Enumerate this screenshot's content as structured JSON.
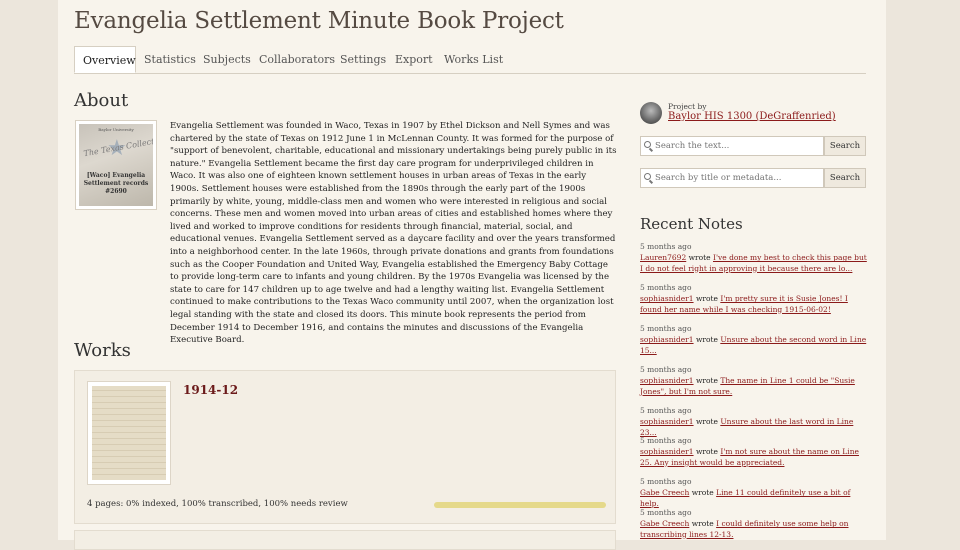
{
  "project_title": "Evangelia Settlement Minute Book Project",
  "tabs": [
    "Overview",
    "Statistics",
    "Subjects",
    "Collaborators",
    "Settings",
    "Export",
    "Works List"
  ],
  "about": {
    "heading": "About",
    "thumb": {
      "top": "Baylor University",
      "collection": "The Texas Collection",
      "label": "[Waco] Evangelia Settlement records #2690"
    },
    "text": "Evangelia Settlement was founded in Waco, Texas in 1907 by Ethel Dickson and Nell Symes and was chartered by the state of Texas on 1912 June 1 in McLennan County. It was formed for the purpose of \"support of benevolent, charitable, educational and missionary undertakings being purely public in its nature.\" Evangelia Settlement became the first day care program for underprivileged children in Waco. It was also one of eighteen known settlement houses in urban areas of Texas in the early 1900s. Settlement houses were established from the 1890s through the early part of the 1900s primarily by white, young, middle-class men and women who were interested in religious and social concerns. These men and women moved into urban areas of cities and established homes where they lived and worked to improve conditions for residents through financial, material, social, and educational venues. Evangelia Settlement served as a daycare facility and over the years transformed into a neighborhood center. In the late 1960s, through private donations and grants from foundations such as the Cooper Foundation and United Way, Evangelia established the Emergency Baby Cottage to provide long-term care to infants and young children. By the 1970s Evangelia was licensed by the state to care for 147 children up to age twelve and had a lengthy waiting list. Evangelia Settlement continued to make contributions to the Texas Waco community until 2007, when the organization lost legal standing with the state and closed its doors. This minute book represents the period from December 1914 to December 1916, and contains the minutes and discussions of the Evangelia Executive Board."
  },
  "works": {
    "heading": "Works",
    "items": [
      {
        "title": "1914-12",
        "stats": "4 pages: 0% indexed, 100% transcribed, 100% needs review",
        "progress": 1.0
      }
    ]
  },
  "owner": {
    "by_label": "Project by",
    "name": "Baylor HIS 1300 (DeGraffenried)"
  },
  "search_text": {
    "placeholder": "Search the text...",
    "button": "Search"
  },
  "search_meta": {
    "placeholder": "Search by title or metadata...",
    "button": "Search"
  },
  "recent_notes": {
    "heading": "Recent Notes",
    "items": [
      {
        "ago": "5 months ago",
        "user": "Lauren7692",
        "verb": "wrote",
        "text": "I've done my best to check this page but I do not feel right in approving it because there are lo..."
      },
      {
        "ago": "5 months ago",
        "user": "sophiasnider1",
        "verb": "wrote",
        "text": "I'm pretty sure it is Susie Jones! I found her name while I was checking 1915-06-02!"
      },
      {
        "ago": "5 months ago",
        "user": "sophiasnider1",
        "verb": "wrote",
        "text": "Unsure about the second word in Line 15..."
      },
      {
        "ago": "5 months ago",
        "user": "sophiasnider1",
        "verb": "wrote",
        "text": "The name in Line 1 could be \"Susie Jones\", but I'm not sure."
      },
      {
        "ago": "5 months ago",
        "user": "sophiasnider1",
        "verb": "wrote",
        "text": "Unsure about the last word in Line 23..."
      },
      {
        "ago": "5 months ago",
        "user": "sophiasnider1",
        "verb": "wrote",
        "text": "I'm not sure about the name on Line 25. Any insight would be appreciated."
      },
      {
        "ago": "5 months ago",
        "user": "Gabe Creech",
        "verb": "wrote",
        "text": "Line 11 could definitely use a bit of help."
      },
      {
        "ago": "5 months ago",
        "user": "Gabe Creech",
        "verb": "wrote",
        "text": "I could definitely use some help on transcribing lines 12-13."
      }
    ]
  }
}
